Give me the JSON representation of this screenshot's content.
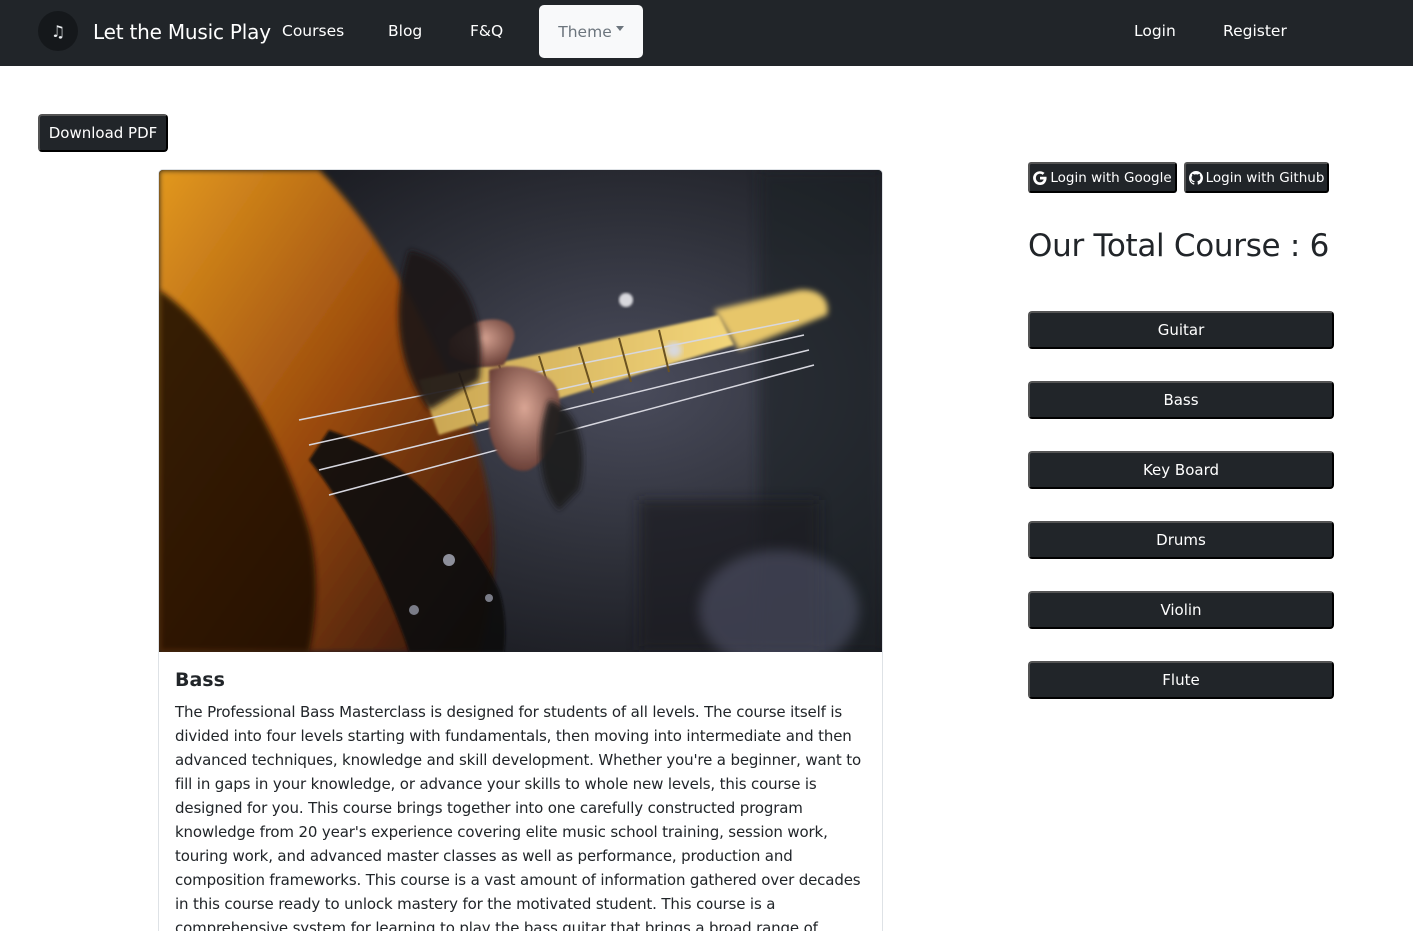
{
  "navbar": {
    "brand_icon": "♫",
    "brand": "Let the Music Play",
    "links": {
      "courses": "Courses",
      "blog": "Blog",
      "faq": "F&Q",
      "login": "Login",
      "register": "Register"
    },
    "theme": "Theme"
  },
  "toolbar": {
    "download_label": "Download PDF"
  },
  "card": {
    "title": "Bass",
    "text": "The Professional Bass Masterclass is designed for students of all levels. The course itself is divided into four levels starting with fundamentals, then moving into intermediate and then advanced techniques, knowledge and skill development. Whether you're a beginner, want to fill in gaps in your knowledge, or advance your skills to whole new levels, this course is designed for you. This course brings together into one carefully constructed program knowledge from 20 year's experience covering elite music school training, session work, touring work, and advanced master classes as well as performance, production and composition frameworks. This course is a vast amount of information gathered over decades in this course ready to unlock mastery for the motivated student. This course is a comprehensive system for learning to play the bass guitar that brings a broad range of musical information together to teach you the skills to be a musician. If"
  },
  "auth": {
    "google_label": "Login with Google",
    "github_label": "Login with Github"
  },
  "total_course": "Our Total Course : 6",
  "courses": [
    {
      "label": "Guitar"
    },
    {
      "label": "Bass"
    },
    {
      "label": "Key Board"
    },
    {
      "label": "Drums"
    },
    {
      "label": "Violin"
    },
    {
      "label": "Flute"
    }
  ],
  "colors": {
    "dark": "#212529",
    "theme_bg": "#f8f9fa",
    "muted": "#6c757d"
  },
  "icons": {
    "brand": "music-note-icon",
    "google": "google-icon",
    "github": "github-icon"
  }
}
